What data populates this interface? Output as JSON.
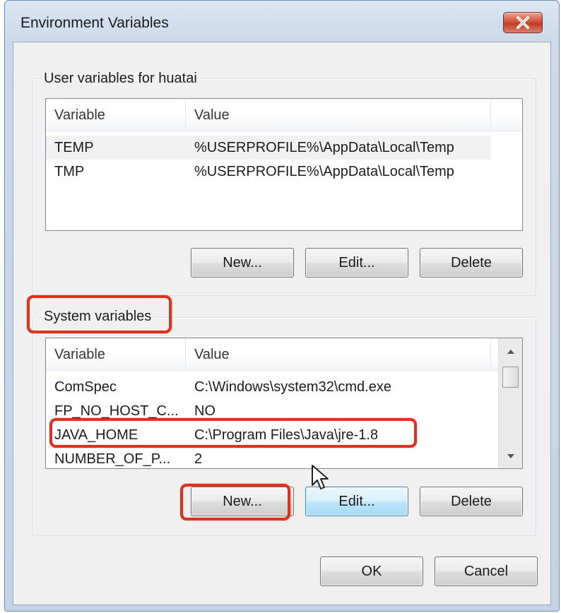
{
  "window": {
    "title": "Environment Variables"
  },
  "user_group": {
    "label": "User variables for huatai",
    "columns": [
      "Variable",
      "Value"
    ],
    "rows": [
      {
        "variable": "TEMP",
        "value": "%USERPROFILE%\\AppData\\Local\\Temp"
      },
      {
        "variable": "TMP",
        "value": "%USERPROFILE%\\AppData\\Local\\Temp"
      }
    ],
    "buttons": {
      "new": "New...",
      "edit": "Edit...",
      "delete": "Delete"
    }
  },
  "system_group": {
    "label": "System variables",
    "columns": [
      "Variable",
      "Value"
    ],
    "rows": [
      {
        "variable": "ComSpec",
        "value": "C:\\Windows\\system32\\cmd.exe"
      },
      {
        "variable": "FP_NO_HOST_C...",
        "value": "NO"
      },
      {
        "variable": "JAVA_HOME",
        "value": "C:\\Program Files\\Java\\jre-1.8"
      },
      {
        "variable": "NUMBER_OF_P...",
        "value": "2"
      }
    ],
    "buttons": {
      "new": "New...",
      "edit": "Edit...",
      "delete": "Delete"
    }
  },
  "dialog_buttons": {
    "ok": "OK",
    "cancel": "Cancel"
  },
  "icons": {
    "close": "close-icon",
    "scroll_up": "chevron-up-icon",
    "scroll_down": "chevron-down-icon",
    "cursor": "mouse-pointer-icon"
  },
  "colors": {
    "highlight": "#e0301e",
    "close_button": "#c23b22",
    "focused_button": "#3c7fb1"
  }
}
